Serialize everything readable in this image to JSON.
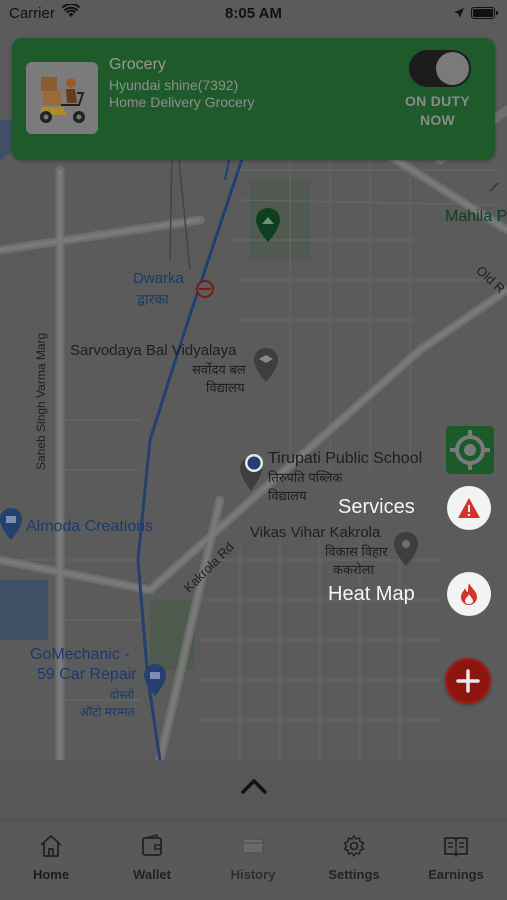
{
  "status_bar": {
    "carrier": "Carrier",
    "time": "8:05 AM"
  },
  "duty_card": {
    "title": "Grocery",
    "vehicle": "Hyundai shine(7392)",
    "service": "Home Delivery Grocery",
    "duty_status": "ON DUTY NOW",
    "duty_on": true,
    "avatar_icon": "delivery-scooter-icon"
  },
  "map": {
    "labels": {
      "mahila": "Mahila P",
      "old": "Old R",
      "dwarka": "Dwarka",
      "dwarka_hi": "द्वारका",
      "sarvodaya": "Sarvodaya Bal Vidyalaya",
      "sarvodaya_hi1": "सर्वोदय बल",
      "sarvodaya_hi2": "विद्यालय",
      "saheb": "Saheb Singh Varma Marg",
      "tirupati": "Tirupati Public School",
      "tirupati_hi1": "तिरुपति पब्लिक",
      "tirupati_hi2": "विद्यालय",
      "almoda": "Almoda Creations",
      "kakrola_rd": "Kakrola Rd",
      "vikas": "Vikas Vihar Kakrola",
      "vikas_hi1": "विकास विहार",
      "vikas_hi2": "ककरोला",
      "gomechanic1": "GoMechanic -",
      "gomechanic2": "59 Car Repair",
      "gomechanic_hi1": "दोस्तो",
      "gomechanic_hi2": "ऑटो मरम्मत"
    }
  },
  "actions": {
    "services_label": "Services",
    "heatmap_label": "Heat Map",
    "colors": {
      "fab_red": "#8c1510",
      "accent_green": "#1d5a2a"
    }
  },
  "tabs": [
    {
      "label": "Home",
      "icon": "home-icon"
    },
    {
      "label": "Wallet",
      "icon": "wallet-icon"
    },
    {
      "label": "History",
      "icon": "history-icon"
    },
    {
      "label": "Settings",
      "icon": "gear-icon"
    },
    {
      "label": "Earnings",
      "icon": "earnings-book-icon"
    }
  ]
}
